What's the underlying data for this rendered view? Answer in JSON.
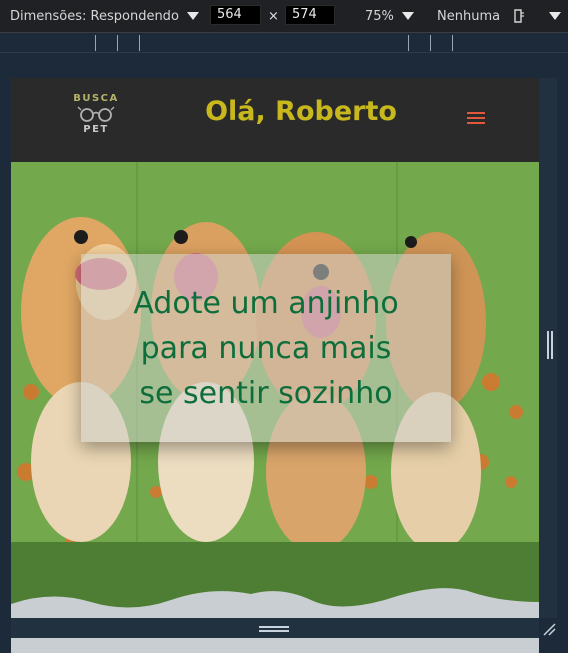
{
  "devtools": {
    "dimensions_label": "Dimensões: Respondendo",
    "width": "564",
    "times": "×",
    "height": "574",
    "zoom": "75%",
    "throttling": "Nenhuma"
  },
  "header": {
    "logo_line1": "BUSCA",
    "logo_line2": "PET",
    "greeting": "Olá, Roberto",
    "menu_icon": "hamburger-menu-icon"
  },
  "hero": {
    "line1": "Adote um anjinho",
    "line2": "para nunca mais",
    "line3": "se sentir sozinho"
  },
  "colors": {
    "header_bg": "#2a2a2a",
    "greeting": "#c8b81d",
    "menu_accent": "#e2583b",
    "hero_text": "#0e6e3b"
  }
}
